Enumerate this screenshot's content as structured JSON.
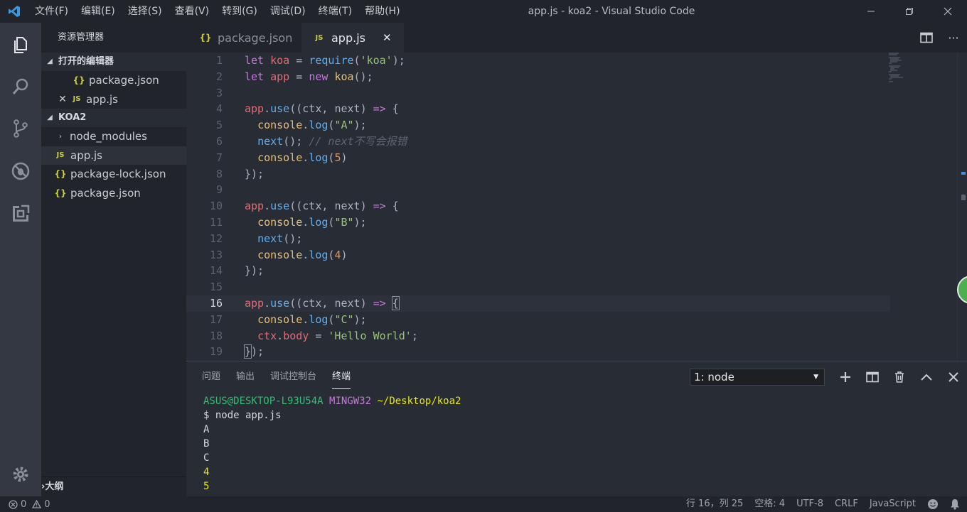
{
  "titlebar": {
    "menu": [
      "文件(F)",
      "编辑(E)",
      "选择(S)",
      "查看(V)",
      "转到(G)",
      "调试(D)",
      "终端(T)",
      "帮助(H)"
    ],
    "window_title": "app.js - koa2 - Visual Studio Code"
  },
  "sidebar": {
    "title": "资源管理器",
    "open_editors_header": "打开的编辑器",
    "open_editors": [
      {
        "name": "package.json",
        "icon": "json-file-icon"
      },
      {
        "name": "app.js",
        "icon": "js-file-icon"
      }
    ],
    "project_header": "KOA2",
    "tree": [
      {
        "name": "node_modules",
        "type": "folder"
      },
      {
        "name": "app.js",
        "type": "js"
      },
      {
        "name": "package-lock.json",
        "type": "json"
      },
      {
        "name": "package.json",
        "type": "json"
      }
    ],
    "outline_header": "大纲"
  },
  "tabs": [
    {
      "label": "package.json",
      "icon": "json-file-icon",
      "active": false
    },
    {
      "label": "app.js",
      "icon": "js-file-icon",
      "active": true
    }
  ],
  "icon_labels": {
    "json": "{}",
    "js": "JS"
  },
  "editor": {
    "current_line": 16,
    "lines": [
      "1",
      "2",
      "3",
      "4",
      "5",
      "6",
      "7",
      "8",
      "9",
      "10",
      "11",
      "12",
      "13",
      "14",
      "15",
      "16",
      "17",
      "18",
      "19"
    ]
  },
  "panel": {
    "tabs": [
      "问题",
      "输出",
      "调试控制台",
      "终端"
    ],
    "active_tab": "终端",
    "terminal_select": "1: node",
    "terminal": {
      "user": "ASUS@DESKTOP-L93U54A",
      "system": "MINGW32",
      "path": "~/Desktop/koa2",
      "command": "$ node app.js",
      "output": [
        "A",
        "B",
        "C",
        "4",
        "5"
      ]
    }
  },
  "statusbar": {
    "errors": "0",
    "warnings": "0",
    "position": "行 16，列 25",
    "indent": "空格: 4",
    "encoding": "UTF-8",
    "eol": "CRLF",
    "language": "JavaScript"
  }
}
